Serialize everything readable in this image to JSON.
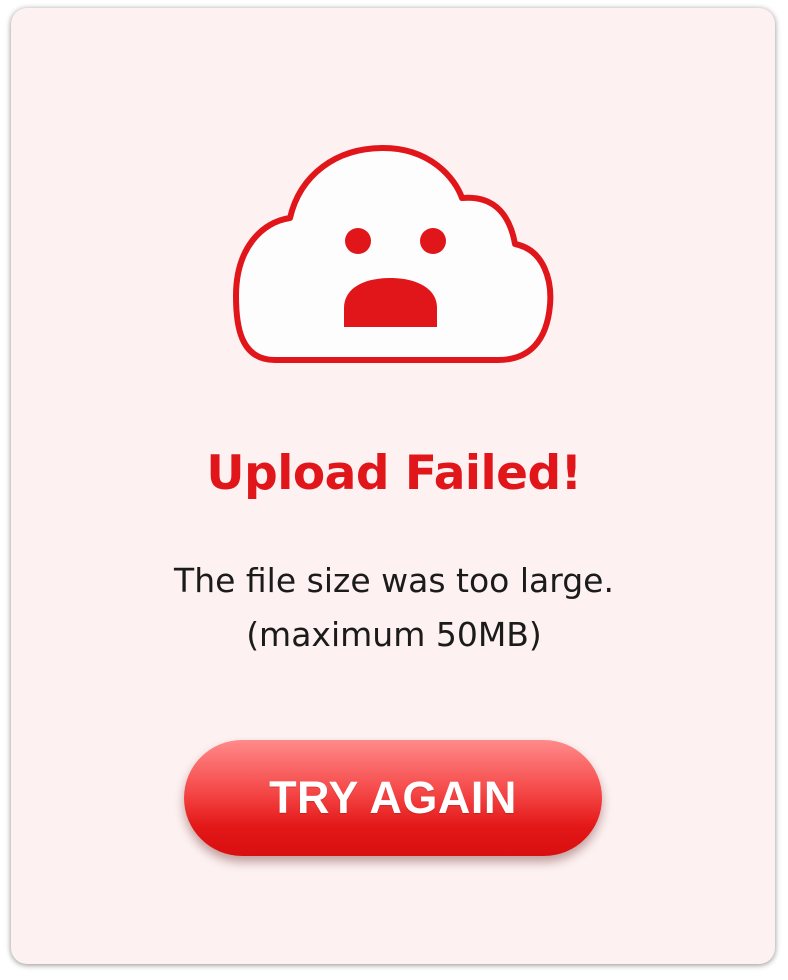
{
  "dialog": {
    "title": "Upload Failed!",
    "message_line1": "The file size was too large.",
    "message_line2": "(maximum 50MB)",
    "button_label": "TRY AGAIN",
    "icon": "sad-cloud-icon"
  },
  "colors": {
    "accent": "#e0161b",
    "card_background": "#fdf1f1",
    "text": "#1b1b1b",
    "button_text": "#ffffff"
  }
}
